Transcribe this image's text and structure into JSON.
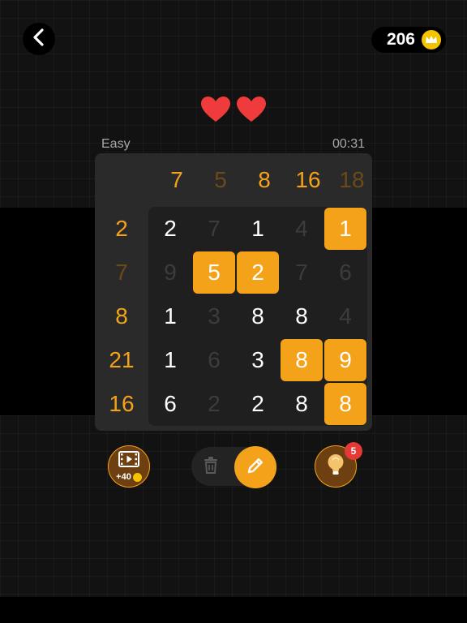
{
  "header": {
    "back_icon": "chevron-left-icon",
    "coins": "206",
    "coin_icon": "crown-coin-icon"
  },
  "lives": {
    "count": 2,
    "icon": "heart-icon",
    "color": "#ef3b3b"
  },
  "status": {
    "difficulty": "Easy",
    "timer": "00:31"
  },
  "colors": {
    "accent": "#f5a21b",
    "sum_done": "#6b4a1a",
    "erased_text": "#3c3c3c",
    "badge": "#e53935"
  },
  "board": {
    "column_sums": [
      {
        "value": "7",
        "state": "active"
      },
      {
        "value": "5",
        "state": "done"
      },
      {
        "value": "8",
        "state": "active"
      },
      {
        "value": "16",
        "state": "active"
      },
      {
        "value": "18",
        "state": "done"
      }
    ],
    "row_sums": [
      {
        "value": "2",
        "state": "active"
      },
      {
        "value": "7",
        "state": "done"
      },
      {
        "value": "8",
        "state": "active"
      },
      {
        "value": "21",
        "state": "active"
      },
      {
        "value": "16",
        "state": "active"
      }
    ],
    "cells": [
      [
        {
          "v": "2",
          "s": "kept"
        },
        {
          "v": "7",
          "s": "erased"
        },
        {
          "v": "1",
          "s": "kept"
        },
        {
          "v": "4",
          "s": "erased"
        },
        {
          "v": "1",
          "s": "circled"
        }
      ],
      [
        {
          "v": "9",
          "s": "erased"
        },
        {
          "v": "5",
          "s": "circled"
        },
        {
          "v": "2",
          "s": "circled"
        },
        {
          "v": "7",
          "s": "erased"
        },
        {
          "v": "6",
          "s": "erased"
        }
      ],
      [
        {
          "v": "1",
          "s": "kept"
        },
        {
          "v": "3",
          "s": "erased"
        },
        {
          "v": "8",
          "s": "kept"
        },
        {
          "v": "8",
          "s": "kept"
        },
        {
          "v": "4",
          "s": "erased"
        }
      ],
      [
        {
          "v": "1",
          "s": "kept"
        },
        {
          "v": "6",
          "s": "erased"
        },
        {
          "v": "3",
          "s": "kept"
        },
        {
          "v": "8",
          "s": "circled"
        },
        {
          "v": "9",
          "s": "circled"
        }
      ],
      [
        {
          "v": "6",
          "s": "kept"
        },
        {
          "v": "2",
          "s": "erased"
        },
        {
          "v": "2",
          "s": "kept"
        },
        {
          "v": "8",
          "s": "kept"
        },
        {
          "v": "8",
          "s": "circled"
        }
      ]
    ]
  },
  "controls": {
    "ad_icon": "video-play-icon",
    "ad_reward": "+40",
    "erase_icon": "trash-icon",
    "pencil_icon": "pencil-icon",
    "hint_icon": "lightbulb-icon",
    "hint_count": "5"
  }
}
